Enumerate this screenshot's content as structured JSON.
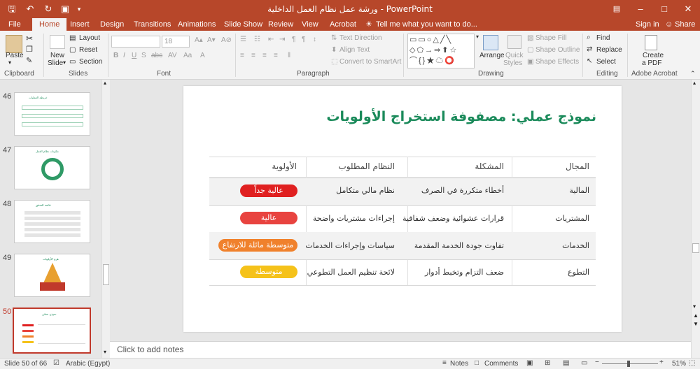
{
  "window": {
    "title": "ورشة عمل نظام العمل الداخلية  -  PowerPoint",
    "controls": [
      "–",
      "□",
      "✕"
    ]
  },
  "tabs": [
    "File",
    "Home",
    "Insert",
    "Design",
    "Transitions",
    "Animations",
    "Slide Show",
    "Review",
    "View",
    "Acrobat"
  ],
  "tell_me": "Tell me what you want to do...",
  "sign_in": "Sign in",
  "share": "Share",
  "ribbon": {
    "clipboard": {
      "paste": "Paste",
      "label": "Clipboard"
    },
    "slides": {
      "new_slide": "New",
      "new_slide2": "Slide",
      "layout": "Layout",
      "reset": "Reset",
      "section": "Section",
      "label": "Slides"
    },
    "font": {
      "size": "18",
      "label": "Font"
    },
    "paragraph": {
      "text_direction": "Text Direction",
      "align_text": "Align Text",
      "smartart": "Convert to SmartArt",
      "label": "Paragraph"
    },
    "drawing": {
      "arrange": "Arrange",
      "quick_styles": "Quick",
      "quick_styles2": "Styles",
      "shape_fill": "Shape Fill",
      "shape_outline": "Shape Outline",
      "shape_effects": "Shape Effects",
      "label": "Drawing"
    },
    "editing": {
      "find": "Find",
      "replace": "Replace",
      "select": "Select",
      "label": "Editing"
    },
    "acrobat": {
      "create": "Create",
      "create2": "a PDF",
      "label": "Adobe Acrobat"
    }
  },
  "thumbnails": [
    {
      "num": "46",
      "title": "خريطة العمليات"
    },
    {
      "num": "47",
      "title": "مكونات نظام العمل"
    },
    {
      "num": "48",
      "title": "قائمة التحقق"
    },
    {
      "num": "49",
      "title": "هرم الأولويات"
    },
    {
      "num": "50",
      "title": "نموذج عملي"
    }
  ],
  "slide": {
    "title": "نموذج عملي: مصفوفة استخراج الأولويات",
    "headers": {
      "domain": "المجال",
      "problem": "المشكلة",
      "system": "النظام المطلوب",
      "priority": "الأولوية"
    },
    "rows": [
      {
        "domain": "المالية",
        "problem": "أخطاء متكررة في الصرف",
        "system": "نظام مالي متكامل",
        "priority": "عالية جداً",
        "color": "#e02020"
      },
      {
        "domain": "المشتريات",
        "problem": "قرارات عشوائية وضعف شفافية",
        "system": "إجراءات مشتريات واضحة",
        "priority": "عالية",
        "color": "#e8433f"
      },
      {
        "domain": "الخدمات",
        "problem": "تفاوت جودة الخدمة المقدمة",
        "system": "سياسات وإجراءات الخدمات",
        "priority": "متوسطة مائلة للارتفاع",
        "color": "#f0812c"
      },
      {
        "domain": "التطوع",
        "problem": "ضعف التزام وتخبط أدوار",
        "system": "لائحة تنظيم العمل التطوعي",
        "priority": "متوسطة",
        "color": "#f5c21a"
      }
    ]
  },
  "notes_placeholder": "Click to add notes",
  "status": {
    "slide": "Slide 50 of 66",
    "language": "Arabic (Egypt)",
    "notes": "Notes",
    "comments": "Comments",
    "zoom": "51%",
    "zoom_fraction": 0.51
  },
  "colors": {
    "accent": "#b7472a",
    "title_green": "#1a8a5a"
  }
}
